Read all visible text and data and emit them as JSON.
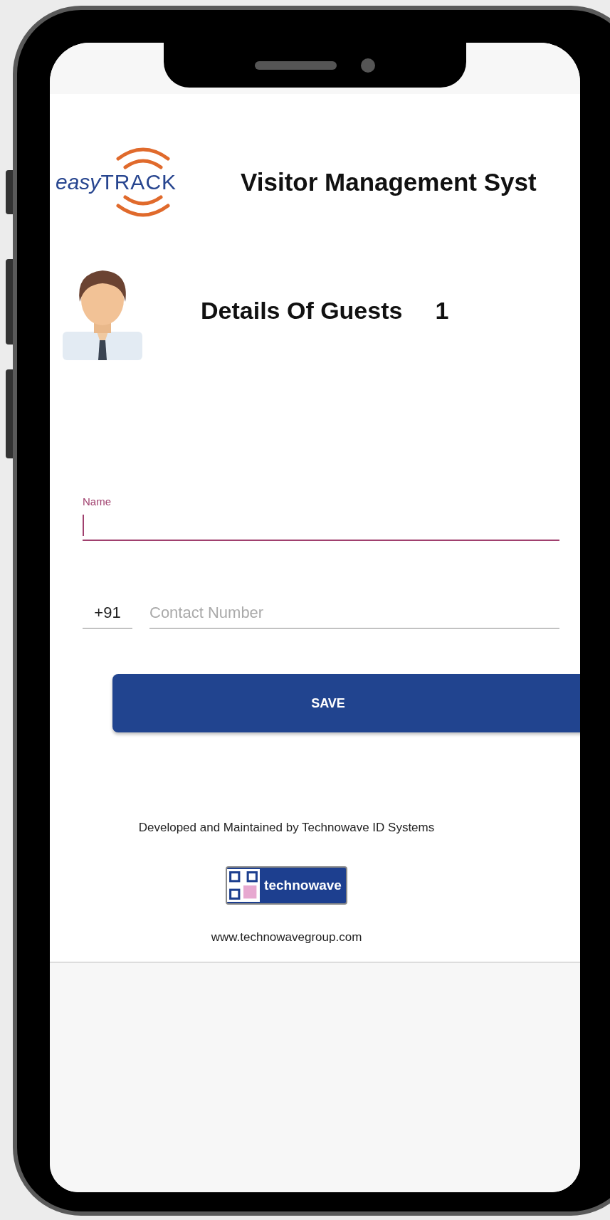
{
  "header": {
    "logo": {
      "brand_prefix": "easy",
      "brand_name": "TRACK"
    },
    "title": "Visitor Management Syst"
  },
  "guest": {
    "heading": "Details Of Guests",
    "count": "1"
  },
  "form": {
    "name_field": {
      "label": "Name",
      "focused": true
    },
    "phone_field": {
      "country_code": "+91",
      "placeholder": "Contact Number"
    },
    "save_button": "SAVE"
  },
  "footer": {
    "credit": "Developed and Maintained by Technowave ID Systems",
    "logo_text": "technowave",
    "url": "www.technowavegroup.com"
  }
}
